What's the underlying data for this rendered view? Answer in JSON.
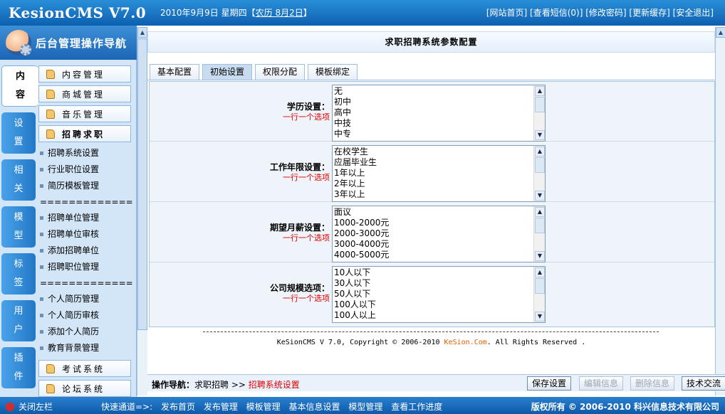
{
  "header": {
    "logo": "KesionCMS V7.0",
    "date_prefix": "2010年9月9日 星期四【",
    "lunar": "农历 8月2日",
    "date_suffix": "】",
    "links": [
      "[网站首页]",
      "[查看短信(0)]",
      "[修改密码]",
      "[更新缓存]",
      "[安全退出]"
    ]
  },
  "nav": {
    "title": "后台管理操作导航",
    "vtabs": [
      {
        "top": "内",
        "bottom": "容"
      },
      {
        "top": "设",
        "bottom": "置"
      },
      {
        "top": "相",
        "bottom": "关"
      },
      {
        "top": "模",
        "bottom": "型"
      },
      {
        "top": "标",
        "bottom": "签"
      },
      {
        "top": "用",
        "bottom": "户"
      },
      {
        "top": "插",
        "bottom": "件"
      }
    ],
    "menu": {
      "content": "内容管理",
      "mall": "商城管理",
      "music": "音乐管理",
      "jobs": "招聘求职",
      "exam": "考试系统",
      "forum": "论坛系统",
      "sub1": [
        "招聘系统设置",
        "行业职位设置",
        "简历模板管理"
      ],
      "sep": "==================",
      "sub2": [
        "招聘单位管理",
        "招聘单位审核",
        "添加招聘单位",
        "招聘职位管理"
      ],
      "sub3": [
        "个人简历管理",
        "个人简历审核",
        "添加个人简历",
        "教育背景管理"
      ]
    }
  },
  "main": {
    "title": "求职招聘系统参数配置",
    "tabs": [
      "基本配置",
      "初始设置",
      "权限分配",
      "模板绑定"
    ],
    "active_tab": 1,
    "fields": [
      {
        "label": "学历设置：",
        "note": "一行一个选项",
        "items": [
          "无",
          "初中",
          "高中",
          "中技",
          "中专"
        ]
      },
      {
        "label": "工作年限设置：",
        "note": "一行一个选项",
        "items": [
          "在校学生",
          "应届毕业生",
          "1年以上",
          "2年以上",
          "3年以上"
        ]
      },
      {
        "label": "期望月薪设置：",
        "note": "一行一个选项",
        "items": [
          "面议",
          "1000-2000元",
          "2000-3000元",
          "3000-4000元",
          "4000-5000元"
        ]
      },
      {
        "label": "公司规模选项：",
        "note": "一行一个选项",
        "items": [
          "10人以下",
          "30人以下",
          "50人以下",
          "100人以下",
          "100人以上"
        ]
      }
    ],
    "copyright_prefix": "KeSionCMS V 7.0, Copyright © 2006-2010 ",
    "copyright_brand": "KeSion.Com",
    "copyright_suffix": ". All Rights Reserved ."
  },
  "actionbar": {
    "crumb_label": "操作导航：",
    "crumb_parent": "求职招聘",
    "crumb_sep": ">>",
    "crumb_current": "招聘系统设置",
    "buttons": {
      "save": "保存设置",
      "edit": "编辑信息",
      "delete": "删除信息",
      "support": "技术交流"
    }
  },
  "footer": {
    "close_left": "关闭左栏",
    "quick_label": "快速通道=>:",
    "quick_links": [
      "发布首页",
      "发布管理",
      "模板管理",
      "基本信息设置",
      "模型管理",
      "查看工作进度"
    ],
    "copyright": "版权所有 © 2006-2010 科兴信息技术有限公司"
  },
  "colors": {
    "brand_blue": "#0c5fb0",
    "note_red": "#e00000",
    "brand_orange": "#e06000"
  }
}
